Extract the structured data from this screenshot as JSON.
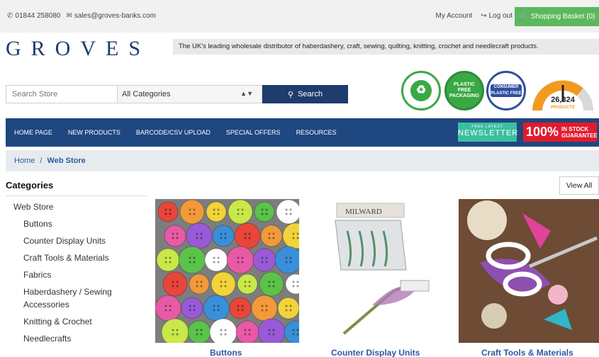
{
  "topbar": {
    "phone": "01844 258080",
    "email": "sales@groves-banks.com",
    "my_account": "My Account",
    "logout": "Log out",
    "basket": "Shopping Basket (0)"
  },
  "logo": {
    "text": "GROVES"
  },
  "tagline": "The UK's leading wholesale distributor of haberdashery, craft, sewing, quilting, knitting, crochet and needlecraft products.",
  "search": {
    "placeholder": "Search Store",
    "category": "All Categories",
    "button": "Search"
  },
  "badges": {
    "recycled": "100% RECYCLED PLASTIC PACKAGING",
    "plastic_free": "PLASTIC FREE PACKAGING",
    "consumer": "CONSUMER PLASTIC FREE PACKAGING"
  },
  "gauge": {
    "count": "26,324",
    "label": "PRODUCTS"
  },
  "nav": {
    "items": [
      "HOME PAGE",
      "NEW PRODUCTS",
      "BARCODE/CSV UPLOAD",
      "SPECIAL OFFERS",
      "RESOURCES"
    ],
    "newsletter_small": "FREE LATEST",
    "newsletter": "NEWSLETTER",
    "instock_pct": "100%",
    "instock_text1": "IN STOCK",
    "instock_text2": "GUARANTEE"
  },
  "breadcrumb": {
    "home": "Home",
    "sep": "/",
    "current": "Web Store"
  },
  "sidebar": {
    "title": "Categories",
    "root": "Web Store",
    "items": [
      "Buttons",
      "Counter Display Units",
      "Craft Tools & Materials",
      "Fabrics",
      "Haberdashery / Sewing Accessories",
      "Knitting & Crochet",
      "Needlecrafts"
    ]
  },
  "view_all": "View All",
  "products": [
    {
      "title": "Buttons",
      "brand": ""
    },
    {
      "title": "Counter Display Units",
      "brand": "MILWARD"
    },
    {
      "title": "Craft Tools & Materials",
      "brand": ""
    }
  ],
  "colors": {
    "navy": "#1f3c6e",
    "nav_blue": "#1f4780",
    "basket_green": "#5cb85c",
    "link_blue": "#2a5aa5",
    "instock_red": "#e21b2e",
    "newsletter_teal": "#3bbfa0",
    "gauge_orange": "#f39a1e"
  },
  "icons": {
    "phone": "phone-icon",
    "email": "envelope-icon",
    "logout": "logout-icon",
    "basket": "cart-icon",
    "search": "search-icon",
    "select": "select-arrow-icon"
  }
}
